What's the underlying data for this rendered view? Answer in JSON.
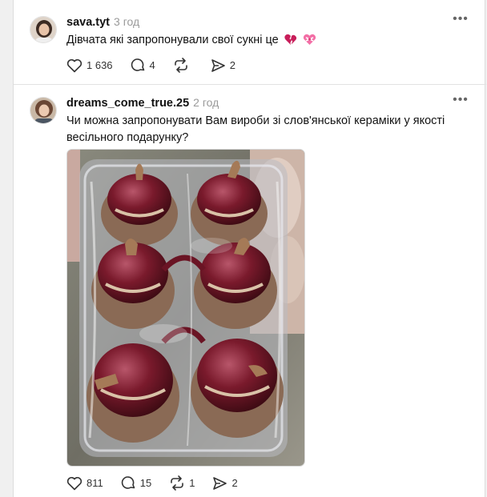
{
  "posts": [
    {
      "username": "sava.tyt",
      "time": "3 год",
      "text": "Дівчата які запропонували свої сукні це",
      "emojis": [
        "broken-heart-icon",
        "ribbon-heart-icon"
      ],
      "likes": "1 636",
      "replies": "4",
      "reposts": "",
      "shares": "2"
    },
    {
      "username": "dreams_come_true.25",
      "time": "2 год",
      "text": "Чи можна запропонувати Вам вироби зі слов'янської кераміки у якості весільного подарунку?",
      "image": "photo of six glazed burgundy ceramic pots with lids wrapped in plastic",
      "likes": "811",
      "replies": "15",
      "reposts": "1",
      "shares": "2"
    }
  ],
  "colors": {
    "text": "#111111",
    "muted": "#9a9a9a",
    "divider": "#e2e2e2",
    "ceramic": "#6e1424"
  }
}
